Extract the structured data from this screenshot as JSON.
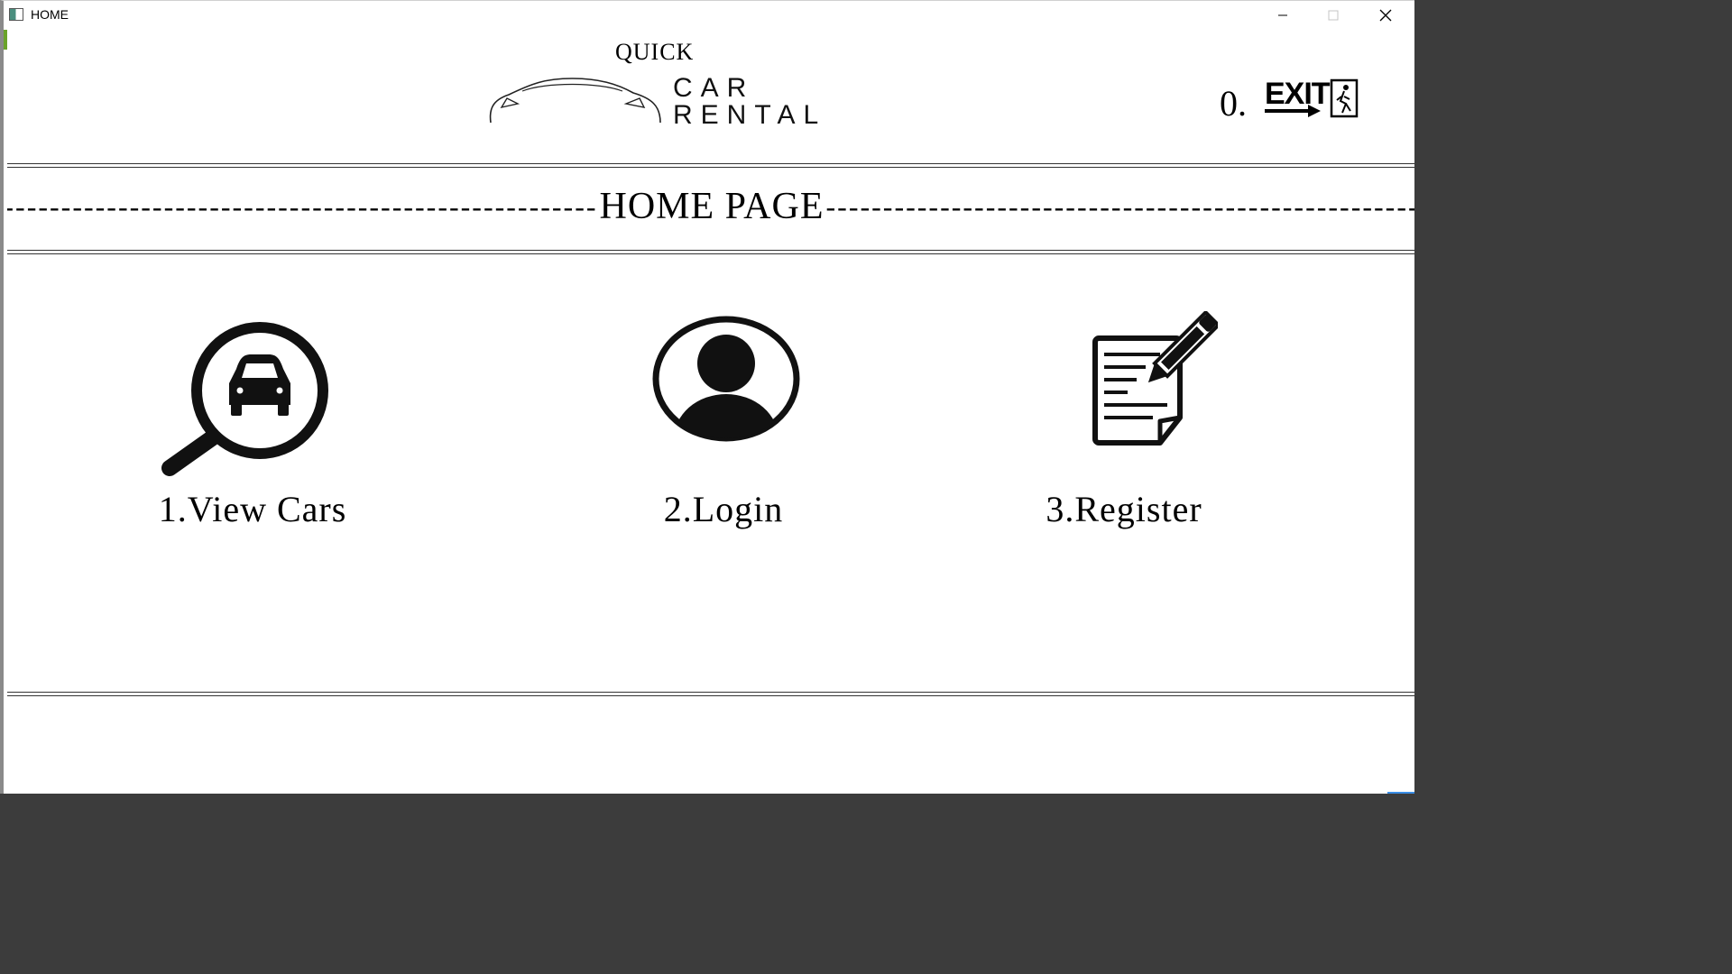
{
  "window": {
    "title": "HOME",
    "controls": {
      "minimize": "─",
      "maximize": "☐",
      "close": "✕"
    }
  },
  "logo": {
    "line1": "QUICK",
    "line2": "CAR",
    "line3": "RENTAL"
  },
  "exit": {
    "number": "0.",
    "label": "EXIT"
  },
  "heading": {
    "dashes_left": "--------------------------------------------------------------------",
    "text": "HOME PAGE",
    "dashes_right": "--------------------------------------------------------------------"
  },
  "options": [
    {
      "label": "1.View Cars",
      "icon": "magnifier-car-icon"
    },
    {
      "label": "2.Login",
      "icon": "user-avatar-icon"
    },
    {
      "label": "3.Register",
      "icon": "document-pencil-icon"
    }
  ],
  "colors": {
    "background": "#ffffff",
    "foreground": "#000000",
    "accent": "#7fb845"
  }
}
